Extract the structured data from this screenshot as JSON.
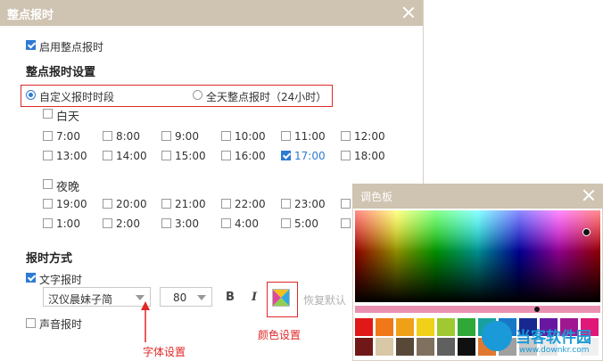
{
  "main_window": {
    "title": "整点报时"
  },
  "enable_checkbox": {
    "label": "启用整点报时",
    "checked": true
  },
  "settings_heading": "整点报时设置",
  "mode": {
    "custom_label": "自定义报时时段",
    "all_day_label": "全天整点报时（24小时）",
    "selected": "custom"
  },
  "day": {
    "label": "白天",
    "times": [
      {
        "t": "7:00",
        "checked": false
      },
      {
        "t": "8:00",
        "checked": false
      },
      {
        "t": "9:00",
        "checked": false
      },
      {
        "t": "10:00",
        "checked": false
      },
      {
        "t": "11:00",
        "checked": false
      },
      {
        "t": "12:00",
        "checked": false
      },
      {
        "t": "13:00",
        "checked": false
      },
      {
        "t": "14:00",
        "checked": false
      },
      {
        "t": "15:00",
        "checked": false
      },
      {
        "t": "16:00",
        "checked": false
      },
      {
        "t": "17:00",
        "checked": true
      },
      {
        "t": "18:00",
        "checked": false
      }
    ]
  },
  "night": {
    "label": "夜晚",
    "times": [
      {
        "t": "19:00",
        "checked": false
      },
      {
        "t": "20:00",
        "checked": false
      },
      {
        "t": "21:00",
        "checked": false
      },
      {
        "t": "22:00",
        "checked": false
      },
      {
        "t": "23:00",
        "checked": false
      },
      {
        "t": "",
        "checked": false
      },
      {
        "t": "1:00",
        "checked": false
      },
      {
        "t": "2:00",
        "checked": false
      },
      {
        "t": "3:00",
        "checked": false
      },
      {
        "t": "4:00",
        "checked": false
      },
      {
        "t": "5:00",
        "checked": false
      },
      {
        "t": "",
        "checked": false
      }
    ]
  },
  "method_heading": "报时方式",
  "text_mode": {
    "label": "文字报时",
    "checked": true
  },
  "font_select": {
    "value": "汉仪晨妹子简"
  },
  "size_select": {
    "value": "80"
  },
  "bold_label": "B",
  "italic_label": "I",
  "restore_label": "恢复默认",
  "voice_mode": {
    "label": "声音报时",
    "checked": false
  },
  "annotations": {
    "font": "字体设置",
    "color": "颜色设置"
  },
  "palette": {
    "title": "调色板",
    "row1": [
      "#e01818",
      "#f07818",
      "#f0a018",
      "#f0d018",
      "#a0c830",
      "#30a838",
      "#18a0a0",
      "#1878c8",
      "#182890",
      "#6818a0",
      "#a01890",
      "#e01878"
    ],
    "row2": [
      "#701818",
      "#d8c8a8",
      "#584838",
      "#807060",
      "#606060",
      "#101010",
      "#e07830",
      "#a0a0a0",
      "#c8c8c8",
      "#e8e8e8",
      "#ffffff",
      "#f0f0f0"
    ]
  },
  "watermark": {
    "text": "当客软件园",
    "url": "www.downkr.com"
  },
  "colors": {
    "titlebar": "#cfc3b1",
    "accent": "#2f7bd3",
    "annotation_red": "#e02828"
  }
}
